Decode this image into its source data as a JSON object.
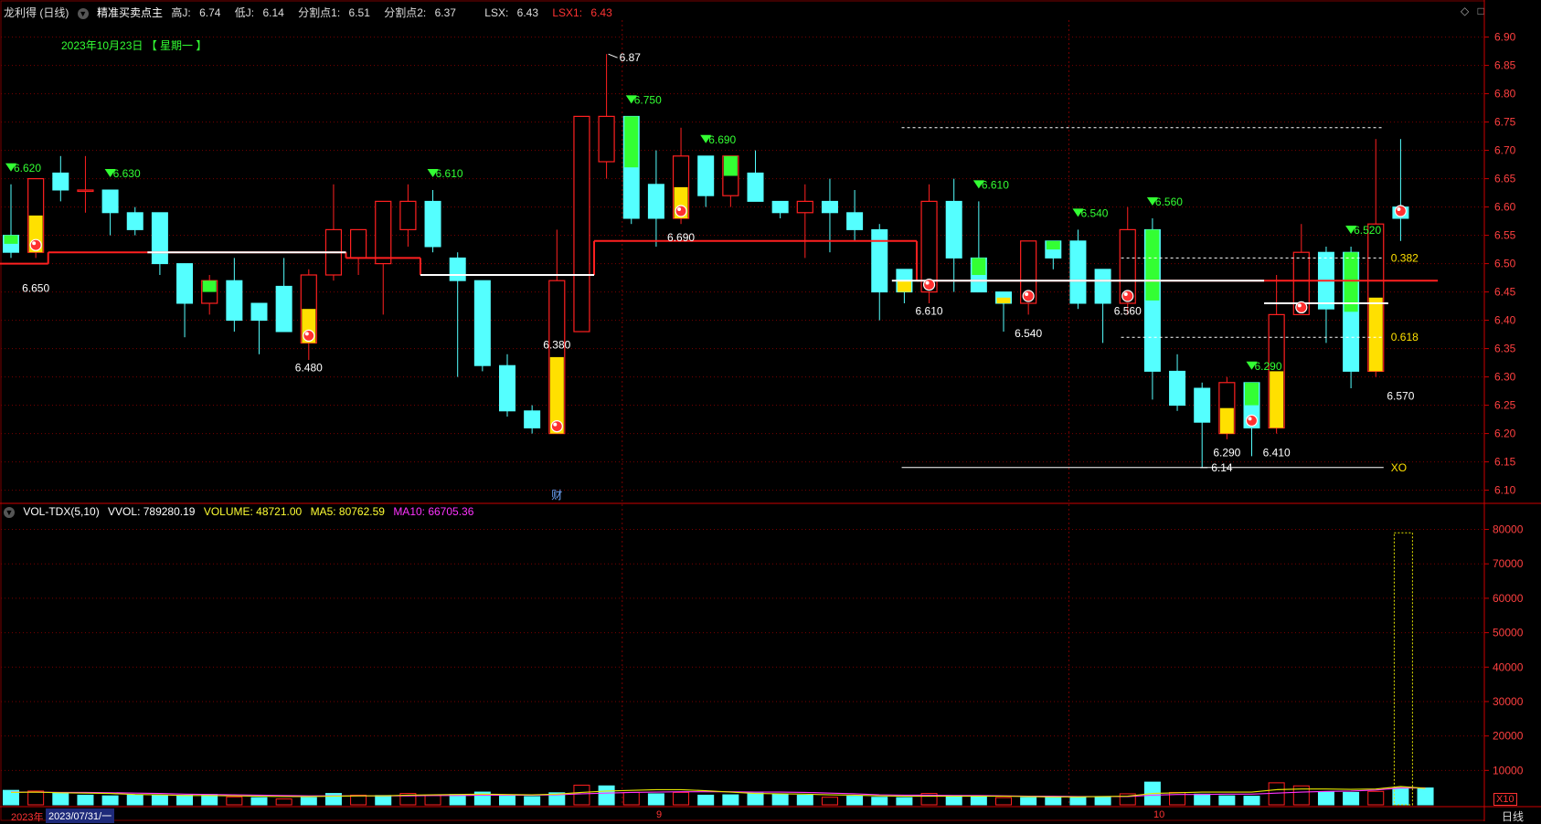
{
  "header": {
    "title": "龙利得 (日线)",
    "indicator_name": "精准买卖点主",
    "stats": [
      {
        "label": "高J:",
        "value": "6.74",
        "color": "#ffffff"
      },
      {
        "label": "低J:",
        "value": "6.14",
        "color": "#ffffff"
      },
      {
        "label": "分割点1:",
        "value": "6.51",
        "color": "#ffffff"
      },
      {
        "label": "分割点2:",
        "value": "6.37",
        "color": "#ffffff"
      },
      {
        "label": "LSX:",
        "value": "6.43",
        "color": "#ffffff"
      },
      {
        "label": "LSX1:",
        "value": "6.43",
        "color": "#ff3333"
      }
    ],
    "date_label": "2023年10月23日 【 星期一 】",
    "window_icons": [
      "◇",
      "□"
    ]
  },
  "vol_header": {
    "name": "VOL-TDX(5,10)",
    "vvol": "VVOL: 789280.19",
    "volume": "VOLUME: 48721.00",
    "ma5": "MA5: 80762.59",
    "ma10": "MA10: 66705.36"
  },
  "footer": {
    "year_label": "2023年",
    "cursor_date": "2023/07/31/一",
    "month_9": "9",
    "month_10": "10",
    "period": "日线",
    "unit": "X10"
  },
  "colors": {
    "up": "#ff2020",
    "down": "#54ffff",
    "buy_fill": "#ffe000",
    "sell_fill": "#33ff33",
    "grid": "#7a0000",
    "axis_text": "#ff4040",
    "support": "#ff2020",
    "ma5": "#e6e600",
    "ma10": "#ff33ff",
    "white": "#ffffff"
  },
  "chart_data": [
    {
      "type": "candlestick",
      "title": "龙利得 (日线)",
      "ylim": [
        6.08,
        6.93
      ],
      "y_ticks": [
        "6.90",
        "6.85",
        "6.80",
        "6.75",
        "6.70",
        "6.65",
        "6.60",
        "6.55",
        "6.50",
        "6.45",
        "6.40",
        "6.35",
        "6.30",
        "6.25",
        "6.20",
        "6.15",
        "6.10"
      ],
      "candles": [
        {
          "o": 6.55,
          "h": 6.64,
          "l": 6.51,
          "c": 6.52
        },
        {
          "o": 6.52,
          "h": 6.65,
          "l": 6.51,
          "c": 6.65
        },
        {
          "o": 6.66,
          "h": 6.69,
          "l": 6.61,
          "c": 6.63
        },
        {
          "o": 6.63,
          "h": 6.69,
          "l": 6.59,
          "c": 6.63
        },
        {
          "o": 6.63,
          "h": 6.63,
          "l": 6.55,
          "c": 6.59
        },
        {
          "o": 6.59,
          "h": 6.6,
          "l": 6.55,
          "c": 6.56
        },
        {
          "o": 6.59,
          "h": 6.59,
          "l": 6.48,
          "c": 6.5
        },
        {
          "o": 6.5,
          "h": 6.5,
          "l": 6.37,
          "c": 6.43
        },
        {
          "o": 6.43,
          "h": 6.48,
          "l": 6.41,
          "c": 6.47
        },
        {
          "o": 6.47,
          "h": 6.51,
          "l": 6.38,
          "c": 6.4
        },
        {
          "o": 6.43,
          "h": 6.43,
          "l": 6.34,
          "c": 6.4
        },
        {
          "o": 6.46,
          "h": 6.51,
          "l": 6.38,
          "c": 6.38
        },
        {
          "o": 6.36,
          "h": 6.49,
          "l": 6.33,
          "c": 6.48
        },
        {
          "o": 6.48,
          "h": 6.64,
          "l": 6.47,
          "c": 6.56
        },
        {
          "o": 6.51,
          "h": 6.56,
          "l": 6.48,
          "c": 6.56
        },
        {
          "o": 6.5,
          "h": 6.61,
          "l": 6.41,
          "c": 6.61
        },
        {
          "o": 6.56,
          "h": 6.64,
          "l": 6.53,
          "c": 6.61
        },
        {
          "o": 6.61,
          "h": 6.63,
          "l": 6.52,
          "c": 6.53
        },
        {
          "o": 6.51,
          "h": 6.52,
          "l": 6.3,
          "c": 6.47
        },
        {
          "o": 6.47,
          "h": 6.47,
          "l": 6.31,
          "c": 6.32
        },
        {
          "o": 6.32,
          "h": 6.34,
          "l": 6.23,
          "c": 6.24
        },
        {
          "o": 6.24,
          "h": 6.25,
          "l": 6.2,
          "c": 6.21
        },
        {
          "o": 6.2,
          "h": 6.56,
          "l": 6.2,
          "c": 6.47
        },
        {
          "o": 6.38,
          "h": 6.76,
          "l": 6.38,
          "c": 6.76
        },
        {
          "o": 6.68,
          "h": 6.87,
          "l": 6.65,
          "c": 6.76
        },
        {
          "o": 6.76,
          "h": 6.76,
          "l": 6.57,
          "c": 6.58
        },
        {
          "o": 6.64,
          "h": 6.7,
          "l": 6.53,
          "c": 6.58
        },
        {
          "o": 6.58,
          "h": 6.74,
          "l": 6.57,
          "c": 6.69
        },
        {
          "o": 6.69,
          "h": 6.69,
          "l": 6.6,
          "c": 6.62
        },
        {
          "o": 6.62,
          "h": 6.69,
          "l": 6.6,
          "c": 6.69
        },
        {
          "o": 6.66,
          "h": 6.7,
          "l": 6.61,
          "c": 6.61
        },
        {
          "o": 6.61,
          "h": 6.61,
          "l": 6.58,
          "c": 6.59
        },
        {
          "o": 6.59,
          "h": 6.64,
          "l": 6.51,
          "c": 6.61
        },
        {
          "o": 6.61,
          "h": 6.65,
          "l": 6.52,
          "c": 6.59
        },
        {
          "o": 6.59,
          "h": 6.63,
          "l": 6.54,
          "c": 6.56
        },
        {
          "o": 6.56,
          "h": 6.57,
          "l": 6.4,
          "c": 6.45
        },
        {
          "o": 6.49,
          "h": 6.49,
          "l": 6.43,
          "c": 6.45
        },
        {
          "o": 6.45,
          "h": 6.64,
          "l": 6.43,
          "c": 6.61
        },
        {
          "o": 6.61,
          "h": 6.65,
          "l": 6.45,
          "c": 6.51
        },
        {
          "o": 6.51,
          "h": 6.61,
          "l": 6.45,
          "c": 6.45
        },
        {
          "o": 6.45,
          "h": 6.45,
          "l": 6.38,
          "c": 6.43
        },
        {
          "o": 6.43,
          "h": 6.54,
          "l": 6.41,
          "c": 6.54
        },
        {
          "o": 6.54,
          "h": 6.54,
          "l": 6.49,
          "c": 6.51
        },
        {
          "o": 6.54,
          "h": 6.56,
          "l": 6.42,
          "c": 6.43
        },
        {
          "o": 6.49,
          "h": 6.49,
          "l": 6.36,
          "c": 6.43
        },
        {
          "o": 6.43,
          "h": 6.6,
          "l": 6.41,
          "c": 6.56
        },
        {
          "o": 6.56,
          "h": 6.58,
          "l": 6.26,
          "c": 6.31
        },
        {
          "o": 6.31,
          "h": 6.34,
          "l": 6.24,
          "c": 6.25
        },
        {
          "o": 6.28,
          "h": 6.29,
          "l": 6.14,
          "c": 6.22
        },
        {
          "o": 6.2,
          "h": 6.3,
          "l": 6.19,
          "c": 6.29
        },
        {
          "o": 6.29,
          "h": 6.29,
          "l": 6.16,
          "c": 6.21
        },
        {
          "o": 6.21,
          "h": 6.48,
          "l": 6.2,
          "c": 6.41
        },
        {
          "o": 6.41,
          "h": 6.57,
          "l": 6.41,
          "c": 6.52
        },
        {
          "o": 6.52,
          "h": 6.53,
          "l": 6.36,
          "c": 6.42
        },
        {
          "o": 6.52,
          "h": 6.53,
          "l": 6.28,
          "c": 6.31
        },
        {
          "o": 6.31,
          "h": 6.72,
          "l": 6.3,
          "c": 6.57
        },
        {
          "o": 6.6,
          "h": 6.72,
          "l": 6.54,
          "c": 6.58
        }
      ],
      "buy_fill_candles": [
        1,
        12,
        22,
        27,
        36,
        40,
        49,
        51,
        55
      ],
      "sell_fill_candles": [
        0,
        8,
        25,
        29,
        39,
        42,
        46,
        50,
        54
      ],
      "buy_markers": [
        1,
        12,
        22,
        27,
        37,
        41,
        45,
        50,
        52,
        56
      ],
      "sell_markers": [
        {
          "i": 0,
          "label": "6.620"
        },
        {
          "i": 4,
          "label": "6.630"
        },
        {
          "i": 17,
          "label": "6.610"
        },
        {
          "i": 25,
          "label": "6.750"
        },
        {
          "i": 28,
          "label": "6.690"
        },
        {
          "i": 39,
          "label": "6.610"
        },
        {
          "i": 43,
          "label": "6.540"
        },
        {
          "i": 46,
          "label": "6.560"
        },
        {
          "i": 50,
          "label": "6.290"
        },
        {
          "i": 54,
          "label": "6.520"
        }
      ],
      "price_labels": [
        {
          "i": 1,
          "y": 6.45,
          "text": "6.650"
        },
        {
          "i": 12,
          "y": 6.31,
          "text": "6.480"
        },
        {
          "i": 22,
          "y": 6.35,
          "text": "6.380"
        },
        {
          "i": 27,
          "y": 6.54,
          "text": "6.690"
        },
        {
          "i": 37,
          "y": 6.41,
          "text": "6.610"
        },
        {
          "i": 41,
          "y": 6.37,
          "text": "6.540"
        },
        {
          "i": 45,
          "y": 6.41,
          "text": "6.560"
        },
        {
          "i": 49,
          "y": 6.16,
          "text": "6.290"
        },
        {
          "i": 51,
          "y": 6.16,
          "text": "6.410"
        },
        {
          "i": 56,
          "y": 6.26,
          "text": "6.570"
        }
      ],
      "high_label": {
        "i": 24,
        "y": 6.87,
        "text": "6.87"
      },
      "low_label": {
        "i": 48,
        "y": 6.14,
        "text": "6.14"
      },
      "support_steps": [
        {
          "from": 0,
          "to": 1,
          "y": 6.5
        },
        {
          "from": 2,
          "to": 13,
          "y": 6.52
        },
        {
          "from": 14,
          "to": 16,
          "y": 6.51
        },
        {
          "from": 17,
          "to": 23,
          "y": 6.48
        },
        {
          "from": 24,
          "to": 36,
          "y": 6.54
        },
        {
          "from": 37,
          "to": 57,
          "y": 6.47
        }
      ],
      "white_line": [
        {
          "from": 6,
          "to": 13,
          "y": 6.52
        },
        {
          "from": 17,
          "to": 23,
          "y": 6.48
        },
        {
          "from": 36,
          "to": 50,
          "y": 6.47
        },
        {
          "from": 51,
          "to": 55,
          "y": 6.43
        }
      ],
      "fib_levels": [
        {
          "y": 6.74,
          "label": ""
        },
        {
          "y": 6.51,
          "label": "0.382"
        },
        {
          "y": 6.37,
          "label": "0.618"
        },
        {
          "y": 6.14,
          "label": "XO"
        }
      ],
      "event_tag": {
        "i": 22,
        "text": "财"
      }
    },
    {
      "type": "bar",
      "title": "VOL-TDX(5,10)",
      "ylim": [
        0,
        82000
      ],
      "y_ticks": [
        "80000",
        "70000",
        "60000",
        "50000",
        "40000",
        "30000",
        "20000",
        "10000"
      ],
      "values": [
        4200,
        4000,
        3400,
        2800,
        2600,
        2900,
        2700,
        2800,
        3000,
        2300,
        2100,
        1700,
        2100,
        3300,
        2800,
        2700,
        3300,
        2700,
        3000,
        3700,
        2700,
        2400,
        3500,
        5700,
        5500,
        3600,
        3200,
        3600,
        2800,
        2900,
        3400,
        3100,
        2800,
        2200,
        2500,
        2200,
        2100,
        3300,
        2700,
        2300,
        2100,
        2100,
        2200,
        2300,
        2300,
        3200,
        6600,
        3600,
        3100,
        2600,
        2500,
        6400,
        5500,
        3800,
        3600,
        3900,
        5000,
        4900
      ],
      "up_days": [
        1,
        9,
        11,
        14,
        16,
        17,
        23,
        25,
        27,
        33,
        37,
        40,
        45,
        47,
        51,
        52,
        55
      ],
      "ma5_values": [
        3600,
        3700,
        3500,
        3400,
        3300,
        3000,
        2900,
        2700,
        2700,
        2600,
        2500,
        2400,
        2400,
        2500,
        2600,
        2600,
        2800,
        2900,
        3000,
        3100,
        3000,
        2900,
        3100,
        3600,
        4000,
        4200,
        4400,
        4400,
        4100,
        3700,
        3300,
        3200,
        3100,
        2900,
        2800,
        2600,
        2500,
        2500,
        2500,
        2500,
        2500,
        2400,
        2300,
        2300,
        2400,
        2500,
        3300,
        3500,
        3700,
        3700,
        3700,
        4400,
        4600,
        4600,
        4500,
        4600,
        5300,
        4800
      ],
      "ma10_values": [
        3700,
        3700,
        3600,
        3600,
        3500,
        3400,
        3300,
        3100,
        3000,
        2900,
        2800,
        2700,
        2600,
        2600,
        2600,
        2600,
        2600,
        2700,
        2700,
        2800,
        2800,
        2800,
        2900,
        3200,
        3400,
        3600,
        3700,
        3800,
        3800,
        3800,
        3700,
        3700,
        3600,
        3400,
        3200,
        2900,
        2800,
        2800,
        2700,
        2700,
        2600,
        2500,
        2500,
        2400,
        2400,
        2400,
        2800,
        3000,
        3000,
        3100,
        3100,
        3400,
        3700,
        3900,
        4000,
        4300,
        4900,
        4900
      ]
    }
  ]
}
